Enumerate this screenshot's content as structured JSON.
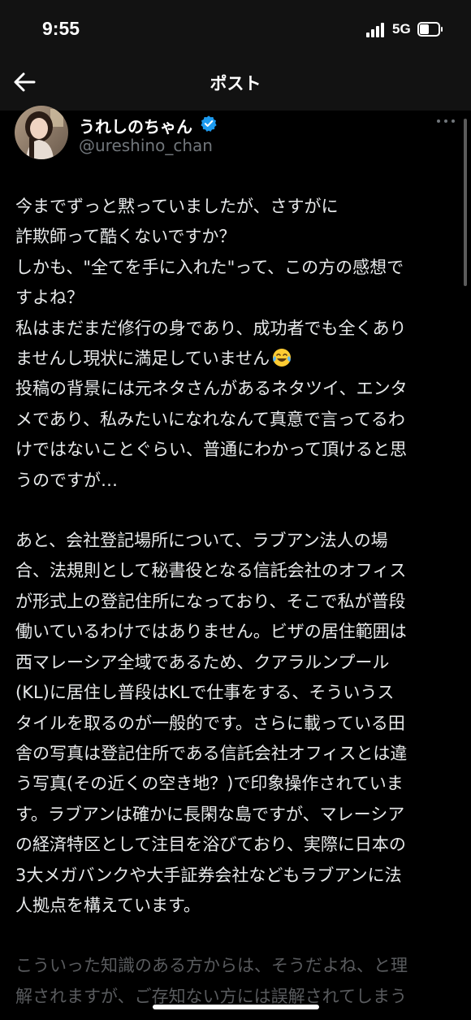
{
  "status_bar": {
    "time": "9:55",
    "network": "5G",
    "battery_level": 0.45
  },
  "nav": {
    "title": "ポスト",
    "back_icon": "arrow-left-icon"
  },
  "author": {
    "display_name": "うれしのちゃん",
    "handle": "@ureshino_chan",
    "verified_icon": "verified-badge-icon",
    "verified_color": "#1d9bf0",
    "more_icon": "more-horizontal-icon"
  },
  "post": {
    "lines": [
      "今までずっと黙っていましたが、さすがに",
      "詐欺師って酷くないですか？",
      "しかも、\"全てを手に入れた\"って、この方の感想で",
      "すよね？",
      "私はまだまだ修行の身であり、成功者でも全くあり",
      "ませんし現状に満足していません",
      "投稿の背景には元ネタさんがあるネタツイ、エンタ",
      "メであり、私みたいになれなんて真意で言ってるわ",
      "けではないことぐらい、普通にわかって頂けると思",
      "うのですが…",
      "",
      "あと、会社登記場所について、ラブアン法人の場",
      "合、法規則として秘書役となる信託会社のオフィス",
      "が形式上の登記住所になっており、そこで私が普段",
      "働いているわけではありません。ビザの居住範囲は",
      "西マレーシア全域であるため、クアラルンプール",
      "(KL)に居住し普段はKLで仕事をする、そういうス",
      "タイルを取るのが一般的です。さらに載っている田",
      "舎の写真は登記住所である信託会社オフィスとは違",
      "う写真(その近くの空き地？)で印象操作されていま",
      "す。ラブアンは確かに長閑な島ですが、マレーシア",
      "の経済特区として注目を浴びており、実際に日本の",
      "3大メガバンクや大手証券会社などもラブアンに法",
      "人拠点を構えています。",
      "",
      "こういった知識のある方からは、そうだよね、と理",
      "解されますが、ご存知ない方には誤解されてしまう"
    ],
    "emoji_after_line_index": 5,
    "emoji_icon": "face-with-tears-of-joy-emoji",
    "fade_from_line_index": 25
  },
  "colors": {
    "background": "#000000",
    "text": "#e7e9ea",
    "secondary_text": "#71767b",
    "header_bg": "#121212"
  }
}
